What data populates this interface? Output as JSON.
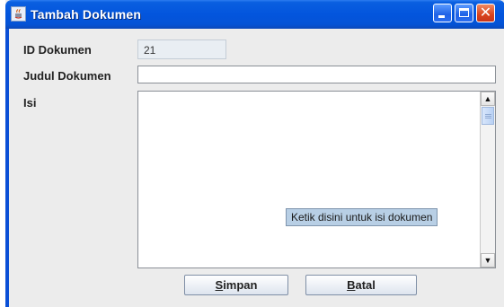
{
  "window": {
    "title": "Tambah Dokumen"
  },
  "form": {
    "id_label": "ID Dokumen",
    "id_value": "21",
    "judul_label": "Judul Dokumen",
    "judul_value": "",
    "isi_label": "Isi",
    "isi_value": "",
    "isi_tooltip": "Ketik disini untuk isi dokumen"
  },
  "buttons": {
    "simpan_mnemonic": "S",
    "simpan_rest": "impan",
    "batal_mnemonic": "B",
    "batal_rest": "atal"
  },
  "icons": {
    "app": "java-app-icon",
    "minimize": "minimize-icon",
    "maximize": "maximize-icon",
    "close": "close-icon",
    "scroll_up": "arrow-up-icon",
    "scroll_down": "arrow-down-icon"
  },
  "colors": {
    "titlebar": "#0355dd",
    "close_button": "#d9441d",
    "tooltip_bg": "#b8cfe5"
  }
}
